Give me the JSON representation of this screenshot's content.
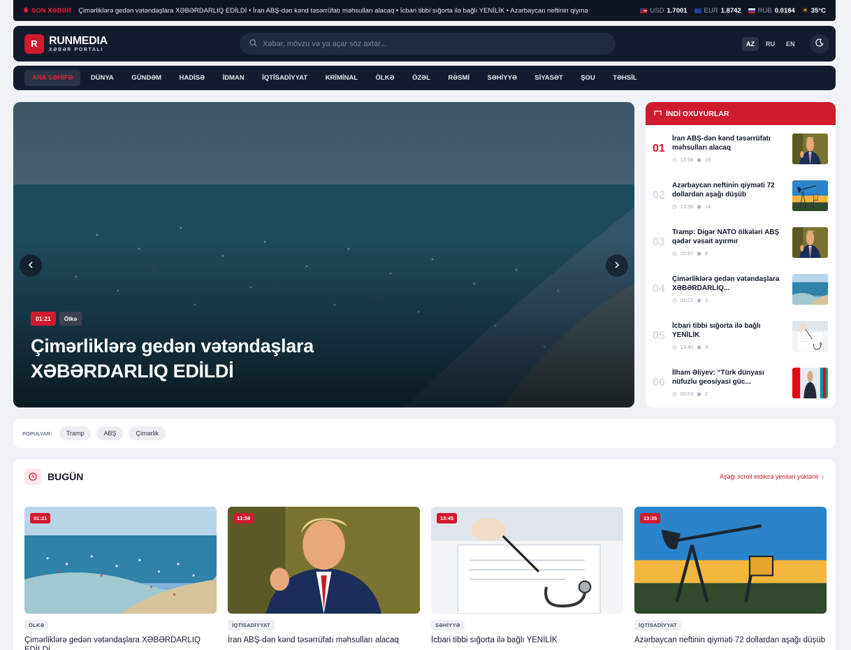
{
  "ticker": {
    "label": "SON XƏBƏR",
    "text": "Çimərliklərə gedən vətəndaşlara XƏBƏRDARLIQ EDİLDİ • İran ABŞ-dən kənd təsərrüfatı məhsulları alacaq • İcbari tibbi sığorta ilə bağlı YENİLİK • Azərbaycan neftinin qiymə",
    "rates": [
      {
        "code": "USD",
        "value": "1.7001"
      },
      {
        "code": "EUR",
        "value": "1.8742"
      },
      {
        "code": "RUB",
        "value": "0.0184"
      }
    ],
    "weather": "35°C"
  },
  "header": {
    "logo_letter": "R",
    "logo_name": "RUNMEDIA",
    "logo_sub": "XƏBƏR PORTALI",
    "search_placeholder": "Xəbər, mövzu və ya açar söz axtar...",
    "languages": [
      "AZ",
      "RU",
      "EN"
    ],
    "active_language": "AZ"
  },
  "nav": {
    "items": [
      "ANA SƏHİFƏ",
      "DÜNYA",
      "GÜNDƏM",
      "HADİSƏ",
      "İDMAN",
      "İQTİSADİYYAT",
      "KRİMİNAL",
      "ÖLKƏ",
      "ÖZƏL",
      "RƏSMİ",
      "SƏHİYYƏ",
      "SİYASƏT",
      "ŞOU",
      "TƏHSİL"
    ],
    "active": "ANA SƏHİFƏ"
  },
  "hero": {
    "time": "01:21",
    "category": "Ölkə",
    "title": "Çimərliklərə gedən vətəndaşlara XƏBƏRDARLIQ EDİLDİ"
  },
  "trending": {
    "title": "İNDİ OXUYURLAR",
    "items": [
      {
        "num": "01",
        "title": "İran ABŞ-dən kənd təsərrüfatı məhsulları alacaq",
        "time": "13:59",
        "views": "19",
        "thumb": "trump"
      },
      {
        "num": "02",
        "title": "Azərbaycan neftinin qiyməti 72 dollardan aşağı düşüb",
        "time": "13:35",
        "views": "14",
        "thumb": "oil"
      },
      {
        "num": "03",
        "title": "Tramp: Digər NATO ölkələri ABŞ qədər vəsait ayırmır",
        "time": "22:57",
        "views": "4",
        "thumb": "trump"
      },
      {
        "num": "04",
        "title": "Çimərliklərə gedən vətəndaşlara XƏBƏRDARLIQ...",
        "time": "01:21",
        "views": "3",
        "thumb": "beach"
      },
      {
        "num": "05",
        "title": "İcbari tibbi sığorta ilə bağlı YENİLİK",
        "time": "13:45",
        "views": "3",
        "thumb": "medical"
      },
      {
        "num": "06",
        "title": "İlham Əliyev: “Türk dünyası nüfuzlu geosiyasi güc...",
        "time": "00:53",
        "views": "2",
        "thumb": "flags"
      }
    ]
  },
  "popular": {
    "label": "POPULYAR:",
    "tags": [
      "Tramp",
      "ABŞ",
      "Çimərlik"
    ]
  },
  "today": {
    "title": "BUGÜN",
    "hint": "Aşağı scroll etdikcə yeniləri yüklənir",
    "cards": [
      {
        "time": "01:21",
        "category": "ÖLKƏ",
        "title": "Çimərliklərə gedən vətəndaşlara XƏBƏRDARLIQ EDİLDİ",
        "image": "beach"
      },
      {
        "time": "13:59",
        "category": "İQTİSADİYYAT",
        "title": "İran ABŞ-dən kənd təsərrüfatı məhsulları alacaq",
        "image": "trump"
      },
      {
        "time": "13:45",
        "category": "SƏHİYYƏ",
        "title": "İcbari tibbi sığorta ilə bağlı YENİLİK",
        "image": "medical"
      },
      {
        "time": "13:35",
        "category": "İQTİSADİYYAT",
        "title": "Azərbaycan neftinin qiyməti 72 dollardan aşağı düşüb",
        "image": "oil"
      }
    ]
  },
  "colors": {
    "accent": "#d11a2f",
    "dark": "#141b2d",
    "background": "#f1f2f5"
  }
}
